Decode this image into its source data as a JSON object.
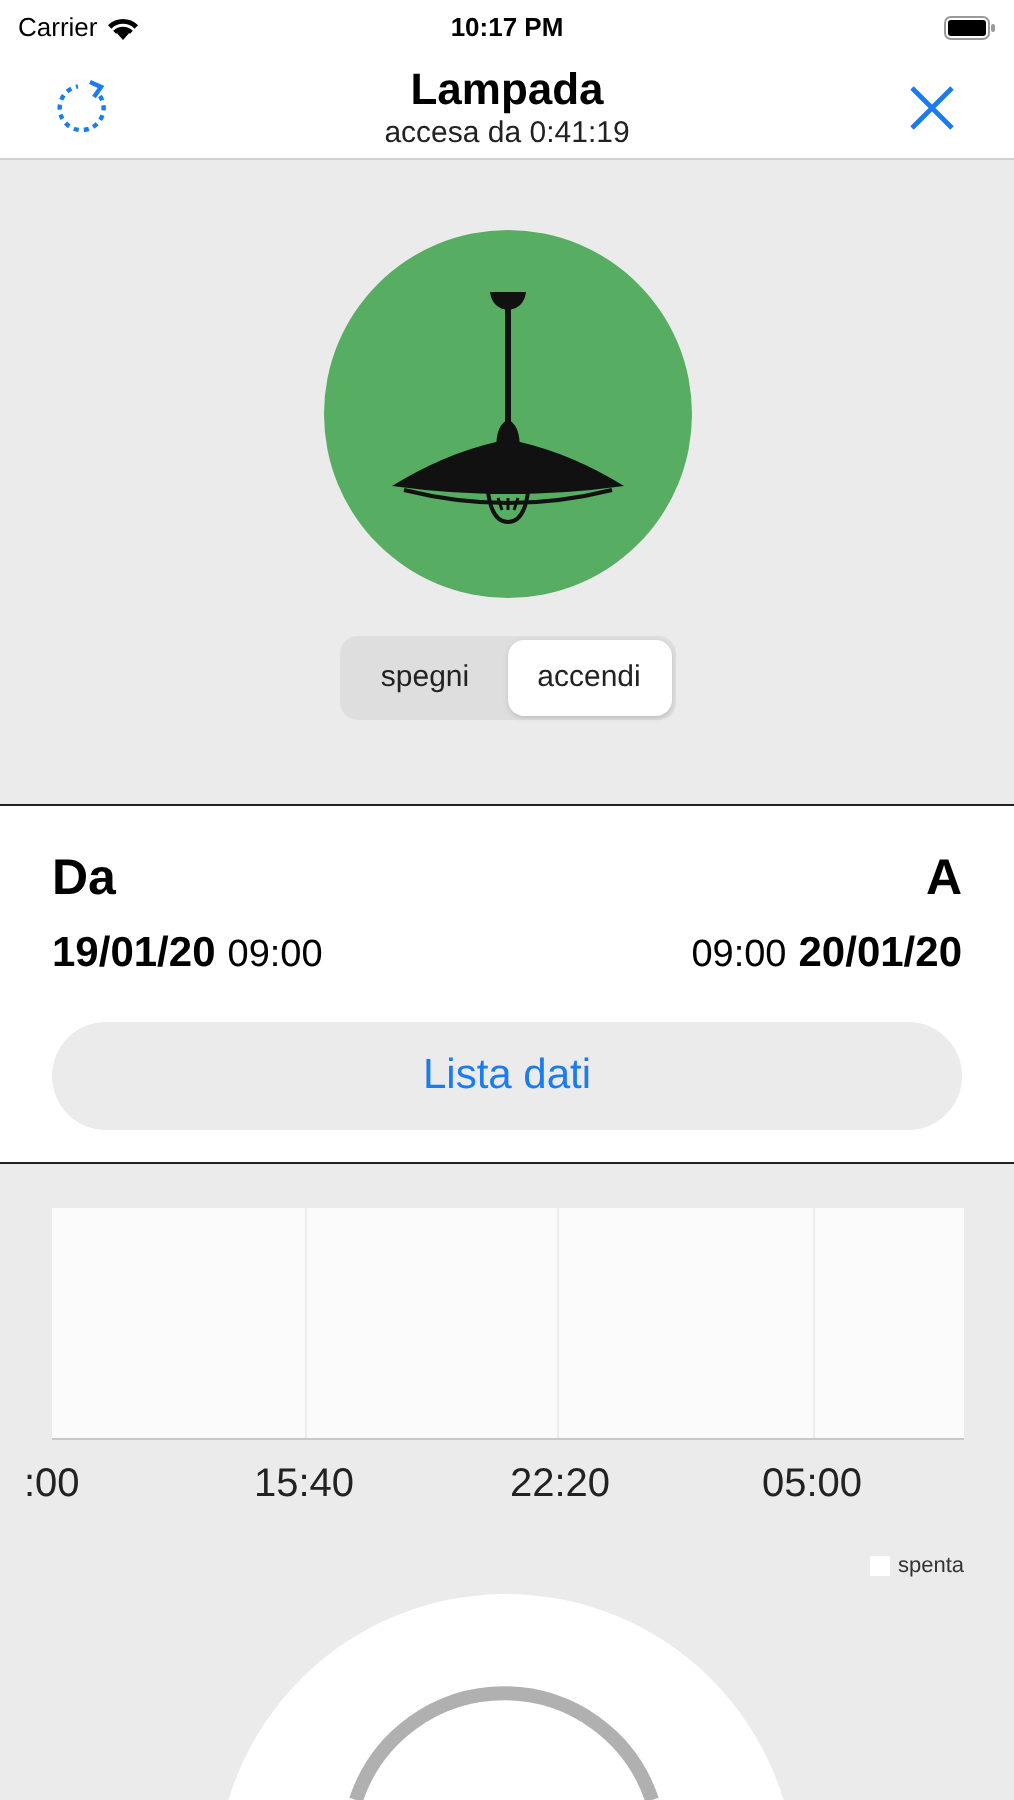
{
  "status_bar": {
    "carrier": "Carrier",
    "time": "10:17 PM"
  },
  "nav": {
    "title": "Lampada",
    "subtitle": "accesa da 0:41:19"
  },
  "lamp": {
    "on": true
  },
  "toggle": [
    {
      "label": "spegni",
      "selected": false
    },
    {
      "label": "accendi",
      "selected": true
    }
  ],
  "range": {
    "from_label": "Da",
    "to_label": "A",
    "from_date": "19/01/20",
    "from_time": "09:00",
    "to_time": "09:00",
    "to_date": "20/01/20"
  },
  "list_button": "Lista dati",
  "timeline": {
    "x_labels": [
      ":00",
      "15:40",
      "22:20",
      "05:00"
    ],
    "legend": [
      {
        "label": "spenta",
        "color": "#ffffff"
      }
    ]
  }
}
